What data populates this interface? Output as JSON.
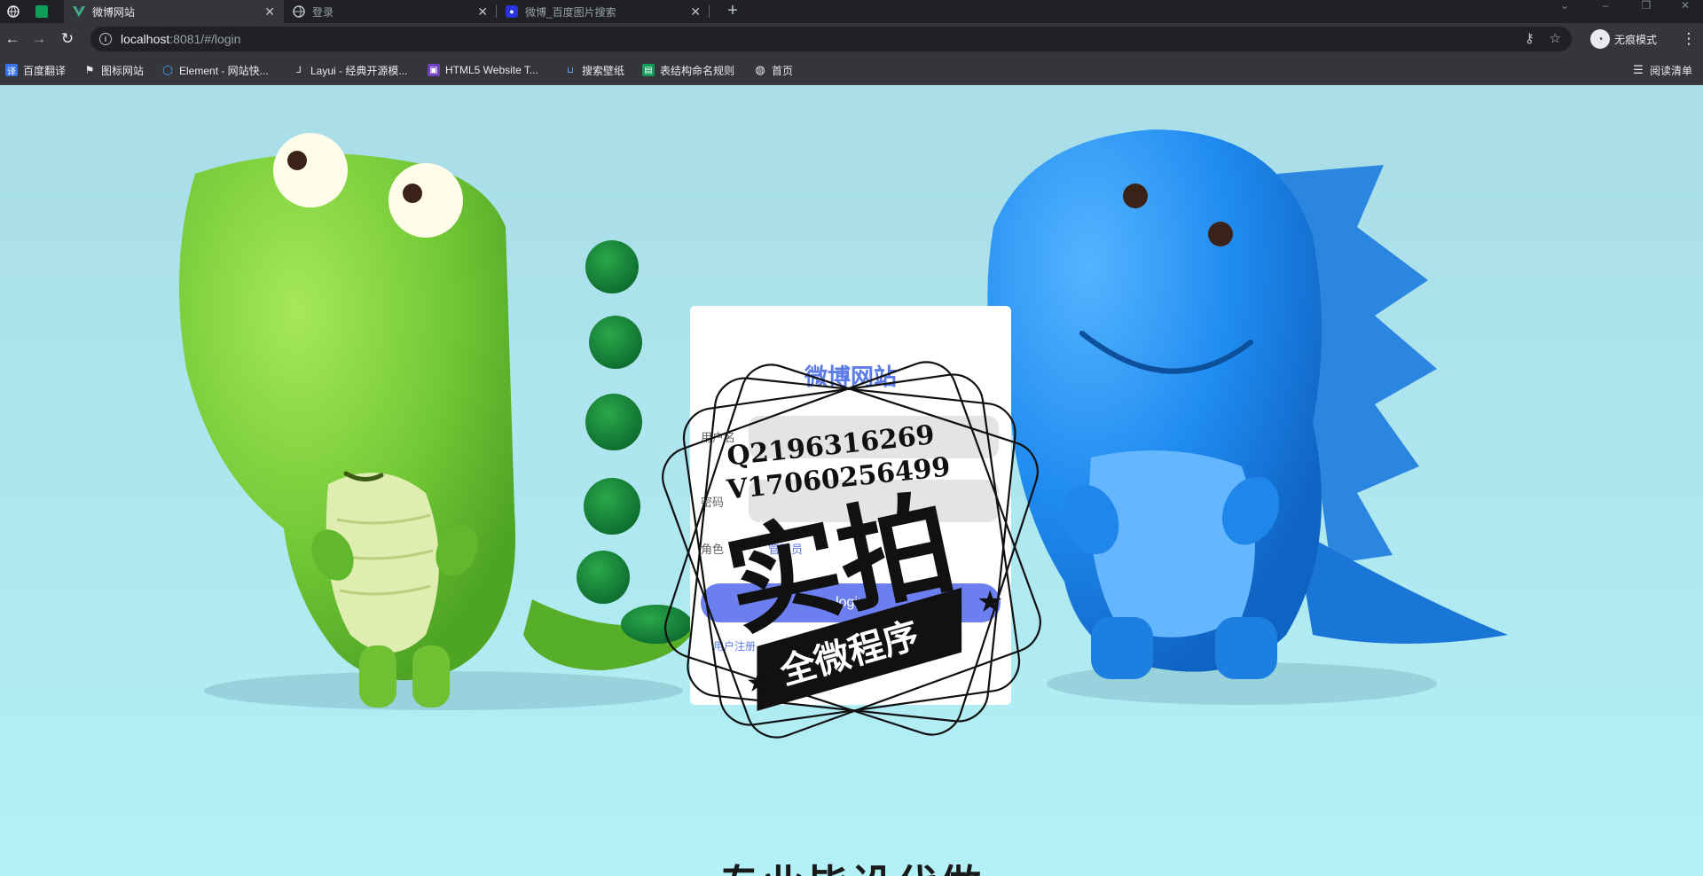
{
  "browser": {
    "tabs": [
      {
        "title": "",
        "icon": "vue-icon"
      },
      {
        "title": "微博网站",
        "icon": "vue-icon",
        "active": true
      },
      {
        "title": "登录",
        "icon": "globe-icon"
      },
      {
        "title": "微博_百度图片搜索",
        "icon": "baidu-paw-icon"
      }
    ],
    "close_glyph": "✕",
    "new_tab_glyph": "+",
    "url_host": "localhost",
    "url_rest": ":8081/#/login",
    "incognito_label": "无痕模式",
    "bookmarks": [
      {
        "label": "百度翻译",
        "color": "#3b73e6"
      },
      {
        "label": "图标网站",
        "color": "#202124"
      },
      {
        "label": "Element - 网站快...",
        "color": "#409eff"
      },
      {
        "label": "Layui - 经典开源模...",
        "color": "#303133"
      },
      {
        "label": "HTML5 Website T...",
        "color": "#6f42c1"
      },
      {
        "label": "搜索壁纸",
        "color": "#2962ff"
      },
      {
        "label": "表结构命名规则",
        "color": "#0f9d58"
      },
      {
        "label": "首页",
        "color": "#5f6368"
      }
    ],
    "reading_list_label": "阅读清单"
  },
  "login": {
    "title": "微博网站",
    "username_label": "用户名",
    "password_label": "密码",
    "role_label": "角色",
    "role_option": "管理员",
    "button": "login",
    "register_link": "用户注册"
  },
  "watermark": {
    "line1": "Q2196316269",
    "line2": "V17060256499",
    "big_text": "实拍",
    "banner_text": "全微程序"
  },
  "bottom_caption": "专业毕设代做"
}
